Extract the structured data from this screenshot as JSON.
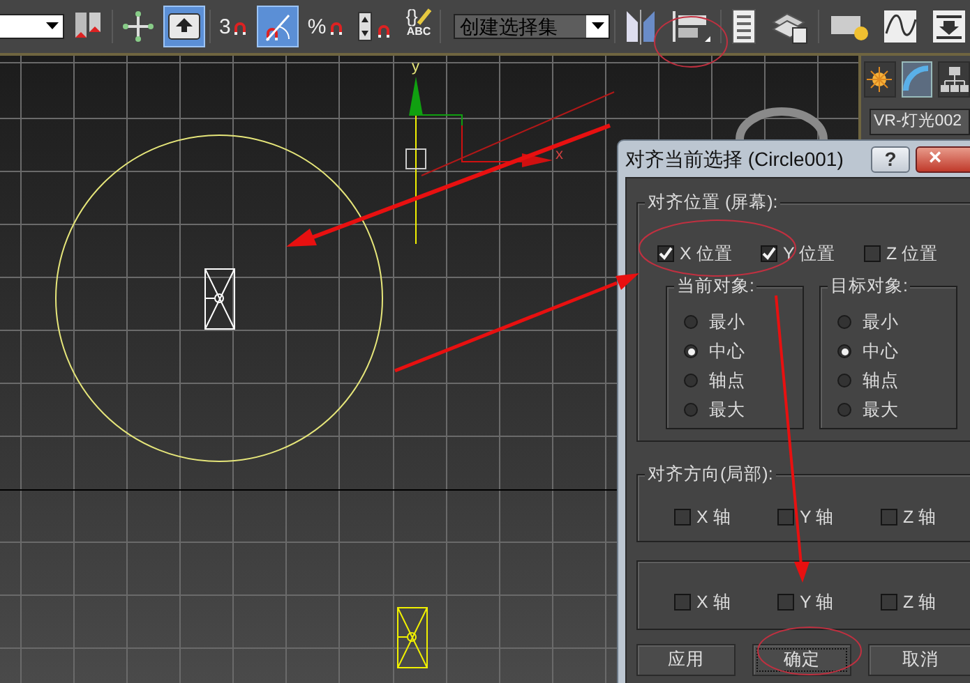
{
  "toolbar": [
    {
      "kind": "combo"
    },
    {
      "kind": "selection-sets",
      "selected": false
    },
    {
      "kind": "move",
      "selected": false
    },
    {
      "kind": "select-link",
      "selected": true
    },
    {
      "kind": "snap",
      "label": "3",
      "selected": false
    },
    {
      "kind": "angle-snap",
      "selected": true
    },
    {
      "kind": "percent-snap",
      "label": "%",
      "selected": false
    },
    {
      "kind": "spinner-snap",
      "selected": false
    },
    {
      "kind": "edit-sets",
      "glyph": "{}",
      "label": "ABC",
      "selected": false
    },
    {
      "kind": "combo",
      "value": "创建选择集"
    },
    {
      "kind": "mirror",
      "selected": false
    },
    {
      "kind": "align",
      "selected": false
    },
    {
      "kind": "list",
      "selected": false
    },
    {
      "kind": "layers",
      "selected": false
    },
    {
      "kind": "render-setup",
      "selected": false
    },
    {
      "kind": "curve",
      "selected": false
    },
    {
      "kind": "schematic",
      "selected": false
    }
  ],
  "viewport": {
    "gizmo": {
      "y_label": "y",
      "x_label": "x"
    }
  },
  "command_panel": {
    "tabs": [
      {
        "kind": "create",
        "selected": false
      },
      {
        "kind": "modify",
        "selected": true
      },
      {
        "kind": "hierarchy",
        "selected": false
      }
    ],
    "object_name": "VR-灯光002"
  },
  "dialog": {
    "title": "对齐当前选择 (Circle001)",
    "help": "?",
    "close": "×",
    "position_group": {
      "label": "对齐位置 (屏幕):",
      "axes": [
        {
          "label": "X 位置",
          "checked": true
        },
        {
          "label": "Y 位置",
          "checked": true
        },
        {
          "label": "Z 位置",
          "checked": false
        }
      ],
      "subgroups": [
        {
          "label": "当前对象:",
          "options": [
            {
              "label": "最小",
              "selected": false
            },
            {
              "label": "中心",
              "selected": true
            },
            {
              "label": "轴点",
              "selected": false
            },
            {
              "label": "最大",
              "selected": false
            }
          ]
        },
        {
          "label": "目标对象:",
          "options": [
            {
              "label": "最小",
              "selected": false
            },
            {
              "label": "中心",
              "selected": true
            },
            {
              "label": "轴点",
              "selected": false
            },
            {
              "label": "最大",
              "selected": false
            }
          ]
        }
      ]
    },
    "orientation_group": {
      "label": "对齐方向(局部):",
      "axes": [
        {
          "label": "X 轴",
          "checked": false
        },
        {
          "label": "Y 轴",
          "checked": false
        },
        {
          "label": "Z 轴",
          "checked": false
        }
      ]
    },
    "scale_group": {
      "axes": [
        {
          "label": "X 轴",
          "checked": false
        },
        {
          "label": "Y 轴",
          "checked": false
        },
        {
          "label": "Z 轴",
          "checked": false
        }
      ]
    },
    "buttons": [
      {
        "label": "应用",
        "focused": false
      },
      {
        "label": "确定",
        "focused": true
      },
      {
        "label": "取消",
        "focused": false
      }
    ]
  }
}
